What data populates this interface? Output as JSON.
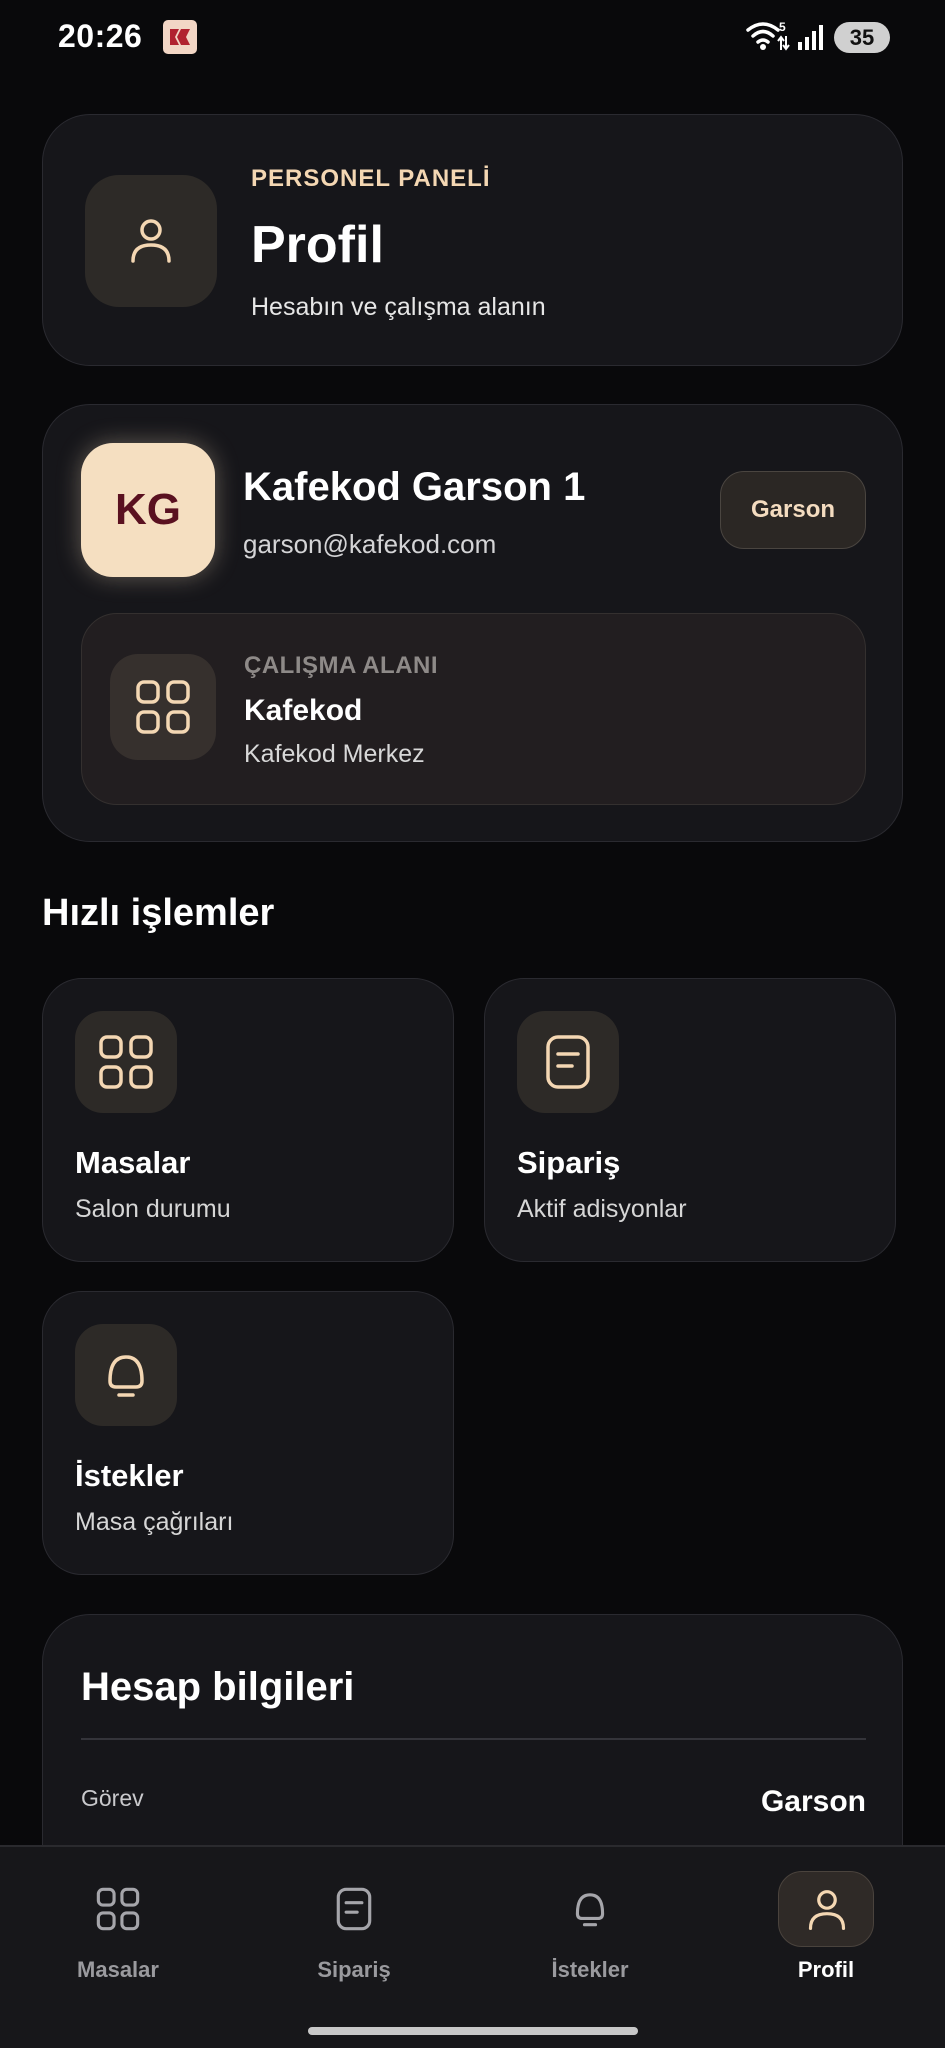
{
  "status_bar": {
    "time": "20:26",
    "network_label": "5",
    "battery": "35",
    "app_icon": "kafekod-app-icon",
    "wifi_icon": "wifi-icon",
    "signal_icon": "cell-signal-icon"
  },
  "header": {
    "kicker": "PERSONEL PANELİ",
    "title": "Profil",
    "subtitle": "Hesabın ve çalışma alanın",
    "icon": "user-icon"
  },
  "profile": {
    "initials": "KG",
    "name": "Kafekod Garson 1",
    "email": "garson@kafekod.com",
    "role": "Garson",
    "workspace": {
      "kicker": "ÇALIŞMA ALANI",
      "name": "Kafekod",
      "branch": "Kafekod Merkez",
      "icon": "grid-icon"
    }
  },
  "quick_actions": {
    "title": "Hızlı işlemler",
    "items": [
      {
        "title": "Masalar",
        "subtitle": "Salon durumu",
        "icon": "grid-icon"
      },
      {
        "title": "Sipariş",
        "subtitle": "Aktif adisyonlar",
        "icon": "receipt-icon"
      },
      {
        "title": "İstekler",
        "subtitle": "Masa çağrıları",
        "icon": "bell-icon"
      }
    ]
  },
  "account": {
    "title": "Hesap bilgileri",
    "rows": [
      {
        "label": "Görev",
        "value": "Garson"
      }
    ]
  },
  "bottom_nav": {
    "items": [
      {
        "label": "Masalar",
        "icon": "grid-icon",
        "active": false
      },
      {
        "label": "Sipariş",
        "icon": "receipt-icon",
        "active": false
      },
      {
        "label": "İstekler",
        "icon": "bell-icon",
        "active": false
      },
      {
        "label": "Profil",
        "icon": "user-icon",
        "active": true
      }
    ]
  },
  "colors": {
    "background": "#09090b",
    "card": "#16161a",
    "accent": "#f4d7b3",
    "avatar_bg": "#f5dfc1",
    "avatar_text": "#5a1120"
  }
}
